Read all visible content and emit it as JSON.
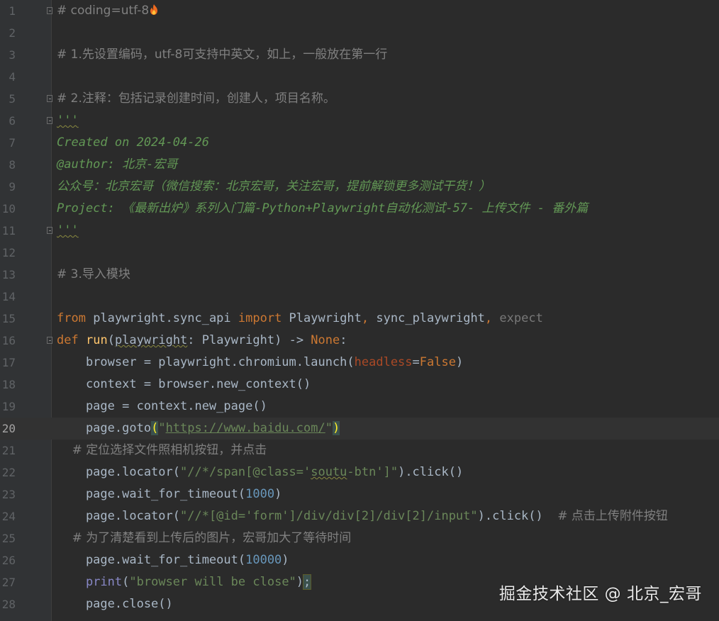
{
  "editor": {
    "current_line": 20,
    "line_numbers": [
      "1",
      "2",
      "3",
      "4",
      "5",
      "6",
      "7",
      "8",
      "9",
      "10",
      "11",
      "12",
      "13",
      "14",
      "15",
      "16",
      "17",
      "18",
      "19",
      "20",
      "21",
      "22",
      "23",
      "24",
      "25",
      "26",
      "27",
      "28"
    ],
    "lines": [
      {
        "tokens": [
          {
            "t": "# coding=utf-8",
            "c": "t-comment"
          }
        ]
      },
      {
        "tokens": []
      },
      {
        "tokens": [
          {
            "t": "# 1.先设置编码，utf-8可支持中英文，如上，一般放在第一行",
            "c": "t-comment"
          }
        ]
      },
      {
        "tokens": []
      },
      {
        "tokens": [
          {
            "t": "# 2.注释：包括记录创建时间，创建人，项目名称。",
            "c": "t-comment"
          }
        ]
      },
      {
        "tokens": [
          {
            "t": "'''",
            "c": "t-doc t-under"
          }
        ]
      },
      {
        "tokens": [
          {
            "t": "Created on 2024-04-26",
            "c": "t-doc"
          }
        ]
      },
      {
        "tokens": [
          {
            "t": "@author: 北京-宏哥",
            "c": "t-doc"
          }
        ]
      },
      {
        "tokens": [
          {
            "t": "公众号：北京宏哥（微信搜索：北京宏哥，关注宏哥，提前解锁更多测试干货！）",
            "c": "t-doc"
          }
        ]
      },
      {
        "tokens": [
          {
            "t": "Project: 《最新出炉》系列入门篇-Python+Playwright自动化测试-57- 上传文件 - 番外篇",
            "c": "t-doc"
          }
        ]
      },
      {
        "tokens": [
          {
            "t": "'''",
            "c": "t-doc t-under"
          }
        ]
      },
      {
        "tokens": []
      },
      {
        "tokens": [
          {
            "t": "# 3.导入模块",
            "c": "t-comment"
          }
        ]
      },
      {
        "tokens": []
      },
      {
        "tokens": [
          {
            "t": "from",
            "c": "t-kw"
          },
          {
            "t": " playwright.sync_api ",
            "c": ""
          },
          {
            "t": "import",
            "c": "t-kw"
          },
          {
            "t": " Playwright",
            "c": ""
          },
          {
            "t": ",",
            "c": "t-kw"
          },
          {
            "t": " sync_playwright",
            "c": ""
          },
          {
            "t": ",",
            "c": "t-kw"
          },
          {
            "t": " expect",
            "c": "t-dim"
          }
        ]
      },
      {
        "tokens": [
          {
            "t": "def",
            "c": "t-kw"
          },
          {
            "t": " ",
            "c": ""
          },
          {
            "t": "run",
            "c": "t-fn"
          },
          {
            "t": "(",
            "c": ""
          },
          {
            "t": "playwright",
            "c": "t-under"
          },
          {
            "t": ": Playwright) -> ",
            "c": ""
          },
          {
            "t": "None",
            "c": "t-kw"
          },
          {
            "t": ":",
            "c": ""
          }
        ]
      },
      {
        "tokens": [
          {
            "t": "    browser = playwright.chromium.launch(",
            "c": ""
          },
          {
            "t": "headless",
            "c": "t-param"
          },
          {
            "t": "=",
            "c": ""
          },
          {
            "t": "False",
            "c": "t-kw"
          },
          {
            "t": ")",
            "c": ""
          }
        ]
      },
      {
        "tokens": [
          {
            "t": "    context = browser.new_context()",
            "c": ""
          }
        ]
      },
      {
        "tokens": [
          {
            "t": "    page = context.new_page()",
            "c": ""
          }
        ]
      },
      {
        "tokens": [
          {
            "t": "    page.goto",
            "c": ""
          },
          {
            "t": "(",
            "c": "t-brace-y"
          },
          {
            "t": "\"",
            "c": "t-str"
          },
          {
            "t": "https://www.baidu.com/",
            "c": "t-link"
          },
          {
            "t": "\"",
            "c": "t-str"
          },
          {
            "t": ")",
            "c": "t-brace-y"
          }
        ]
      },
      {
        "tokens": [
          {
            "t": "    # 定位选择文件照相机按钮，并点击",
            "c": "t-comment"
          }
        ]
      },
      {
        "tokens": [
          {
            "t": "    page.locator(",
            "c": ""
          },
          {
            "t": "\"//*/span[@class='",
            "c": "t-str"
          },
          {
            "t": "soutu",
            "c": "t-str t-under"
          },
          {
            "t": "-btn']\"",
            "c": "t-str"
          },
          {
            "t": ").click()",
            "c": ""
          }
        ]
      },
      {
        "tokens": [
          {
            "t": "    page.wait_for_timeout(",
            "c": ""
          },
          {
            "t": "1000",
            "c": "t-num"
          },
          {
            "t": ")",
            "c": ""
          }
        ]
      },
      {
        "tokens": [
          {
            "t": "    page.locator(",
            "c": ""
          },
          {
            "t": "\"//*[@id='form']/div/div[2]/div[2]/input\"",
            "c": "t-str"
          },
          {
            "t": ").click()  ",
            "c": ""
          },
          {
            "t": "# 点击上传附件按钮",
            "c": "t-comment"
          }
        ]
      },
      {
        "tokens": [
          {
            "t": "    # 为了清楚看到上传后的图片，宏哥加大了等待时间",
            "c": "t-comment"
          }
        ]
      },
      {
        "tokens": [
          {
            "t": "    page.wait_for_timeout(",
            "c": ""
          },
          {
            "t": "10000",
            "c": "t-num"
          },
          {
            "t": ")",
            "c": ""
          }
        ]
      },
      {
        "tokens": [
          {
            "t": "    ",
            "c": ""
          },
          {
            "t": "print",
            "c": "t-builtin"
          },
          {
            "t": "(",
            "c": ""
          },
          {
            "t": "\"browser will be close\"",
            "c": "t-str"
          },
          {
            "t": ")",
            "c": ""
          },
          {
            "t": ";",
            "c": "t-brace"
          }
        ]
      },
      {
        "tokens": [
          {
            "t": "    page.close()",
            "c": ""
          }
        ]
      }
    ],
    "fold_lines": [
      1,
      5,
      6,
      11,
      16
    ]
  },
  "watermark": {
    "text": "掘金技术社区 @ 北京_宏哥"
  },
  "icons": {
    "line1_trailing": "flame-icon"
  },
  "colors": {
    "background": "#2b2b2b",
    "gutter": "#313335",
    "current_line": "#323232",
    "comment": "#808080",
    "docstring": "#629755",
    "keyword": "#cc7832",
    "function": "#ffc66d",
    "string": "#6a8759",
    "number": "#6897bb",
    "parameter": "#aa4926",
    "builtin": "#8888c6",
    "text": "#a9b7c6"
  }
}
